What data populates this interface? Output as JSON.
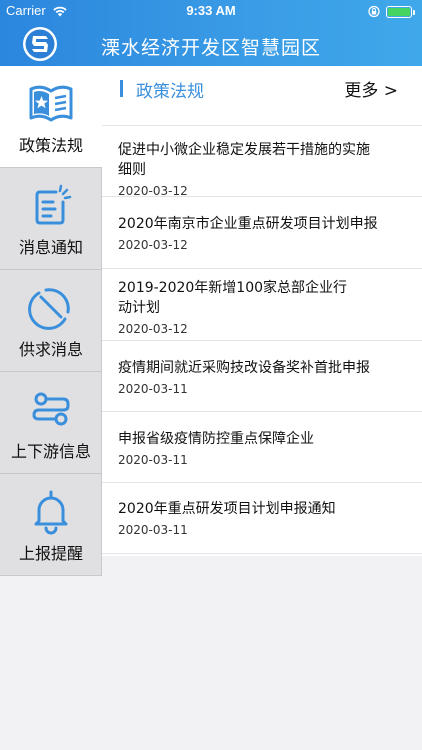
{
  "status": {
    "carrier": "Carrier",
    "time": "9:33 AM",
    "battery_level": 1.0,
    "battery_color": "#45d461"
  },
  "nav": {
    "title": "溧水经济开发区智慧园区",
    "logo_icon": "park-logo-icon"
  },
  "sidebar": {
    "items": [
      {
        "label": "政策法规",
        "icon": "policy-book-icon",
        "active": true
      },
      {
        "label": "消息通知",
        "icon": "notice-document-icon",
        "active": false
      },
      {
        "label": "供求消息",
        "icon": "supply-demand-icon",
        "active": false
      },
      {
        "label": "上下游信息",
        "icon": "upstream-downstream-icon",
        "active": false
      },
      {
        "label": "上报提醒",
        "icon": "bell-icon",
        "active": false
      }
    ]
  },
  "main": {
    "section_title": "政策法规",
    "more_label": "更多 >",
    "news": [
      {
        "title_lines": [
          "促进中小微企业稳定发展若干措施的实施",
          "细则"
        ],
        "date": "2020-03-12"
      },
      {
        "title_lines": [
          "2020年南京市企业重点研发项目计划申报"
        ],
        "date": "2020-03-12"
      },
      {
        "title_lines": [
          "2019-2020年新增100家总部企业行",
          "动计划"
        ],
        "date": "2020-03-12"
      },
      {
        "title_lines": [
          "疫情期间就近采购技改设备奖补首批申报"
        ],
        "date": "2020-03-11"
      },
      {
        "title_lines": [
          "申报省级疫情防控重点保障企业"
        ],
        "date": "2020-03-11"
      },
      {
        "title_lines": [
          "2020年重点研发项目计划申报通知"
        ],
        "date": "2020-03-11"
      }
    ]
  },
  "colors": {
    "brand_blue": "#2b86dd",
    "accent_blue": "#3a8fdc",
    "sidebar_bg": "#e0e0e2",
    "page_bg": "#f2f2f4"
  }
}
